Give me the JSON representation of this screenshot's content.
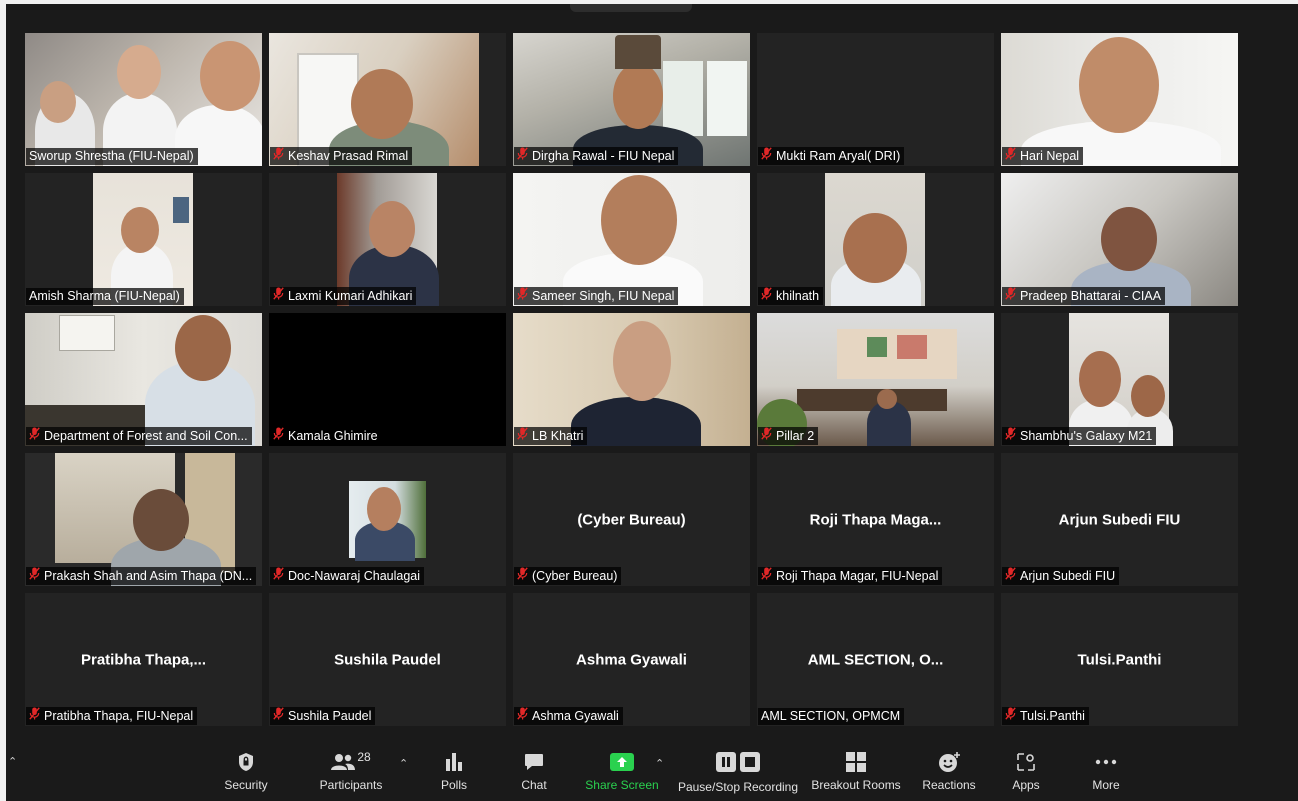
{
  "colors": {
    "background": "#1a1a1a",
    "tile": "#232323",
    "muted_mic": "#e02828",
    "share_green": "#2ad14f"
  },
  "tiles": [
    {
      "name": "Sworup Shrestha (FIU-Nepal)",
      "muted": false,
      "video": true
    },
    {
      "name": "Keshav Prasad Rimal",
      "muted": true,
      "video": true
    },
    {
      "name": "Dirgha Rawal - FIU Nepal",
      "muted": true,
      "video": true
    },
    {
      "name": "Mukti Ram Aryal( DRI)",
      "muted": true,
      "video": false
    },
    {
      "name": "Hari Nepal",
      "muted": true,
      "video": true
    },
    {
      "name": "Amish Sharma (FIU-Nepal)",
      "muted": false,
      "video": true
    },
    {
      "name": "Laxmi Kumari Adhikari",
      "muted": true,
      "video": true
    },
    {
      "name": "Sameer Singh, FIU Nepal",
      "muted": true,
      "video": true
    },
    {
      "name": "khilnath",
      "muted": true,
      "video": true
    },
    {
      "name": "Pradeep Bhattarai - CIAA",
      "muted": true,
      "video": true
    },
    {
      "name": "Department of Forest and Soil Con...",
      "muted": true,
      "video": true
    },
    {
      "name": "Kamala Ghimire",
      "muted": true,
      "video": false
    },
    {
      "name": "LB Khatri",
      "muted": true,
      "video": true
    },
    {
      "name": "Pillar 2",
      "muted": true,
      "video": true
    },
    {
      "name": "Shambhu's Galaxy M21",
      "muted": true,
      "video": true
    },
    {
      "name": "Prakash Shah and Asim Thapa (DN...",
      "muted": true,
      "video": true
    },
    {
      "name": "Doc-Nawaraj Chaulagai",
      "muted": true,
      "video": true
    },
    {
      "name": "(Cyber Bureau)",
      "muted": true,
      "video": false,
      "center": "(Cyber Bureau)"
    },
    {
      "name": "Roji Thapa Magar, FIU-Nepal",
      "muted": true,
      "video": false,
      "center": "Roji Thapa Maga..."
    },
    {
      "name": "Arjun Subedi FIU",
      "muted": true,
      "video": false,
      "center": "Arjun Subedi FIU"
    },
    {
      "name": "Pratibha Thapa, FIU-Nepal",
      "muted": true,
      "video": false,
      "center": "Pratibha Thapa,..."
    },
    {
      "name": "Sushila Paudel",
      "muted": true,
      "video": false,
      "center": "Sushila Paudel"
    },
    {
      "name": "Ashma Gyawali",
      "muted": true,
      "video": false,
      "center": "Ashma Gyawali"
    },
    {
      "name": "AML SECTION, OPMCM",
      "muted": false,
      "video": false,
      "center": "AML SECTION, O..."
    },
    {
      "name": "Tulsi.Panthi",
      "muted": true,
      "video": false,
      "center": "Tulsi.Panthi"
    }
  ],
  "toolbar": {
    "security": "Security",
    "participants": "Participants",
    "participants_count": "28",
    "polls": "Polls",
    "chat": "Chat",
    "share_screen": "Share Screen",
    "recording": "Pause/Stop Recording",
    "breakout": "Breakout Rooms",
    "reactions": "Reactions",
    "apps": "Apps",
    "more": "More"
  },
  "icons": {
    "security": "shield-icon",
    "participants": "people-icon",
    "polls": "bar-chart-icon",
    "chat": "speech-bubble-icon",
    "share_screen": "share-arrow-icon",
    "recording": "pause-stop-icon",
    "breakout": "grid-icon",
    "reactions": "smiley-icon",
    "apps": "apps-icon",
    "more": "ellipsis-icon",
    "muted": "mic-off-icon"
  }
}
